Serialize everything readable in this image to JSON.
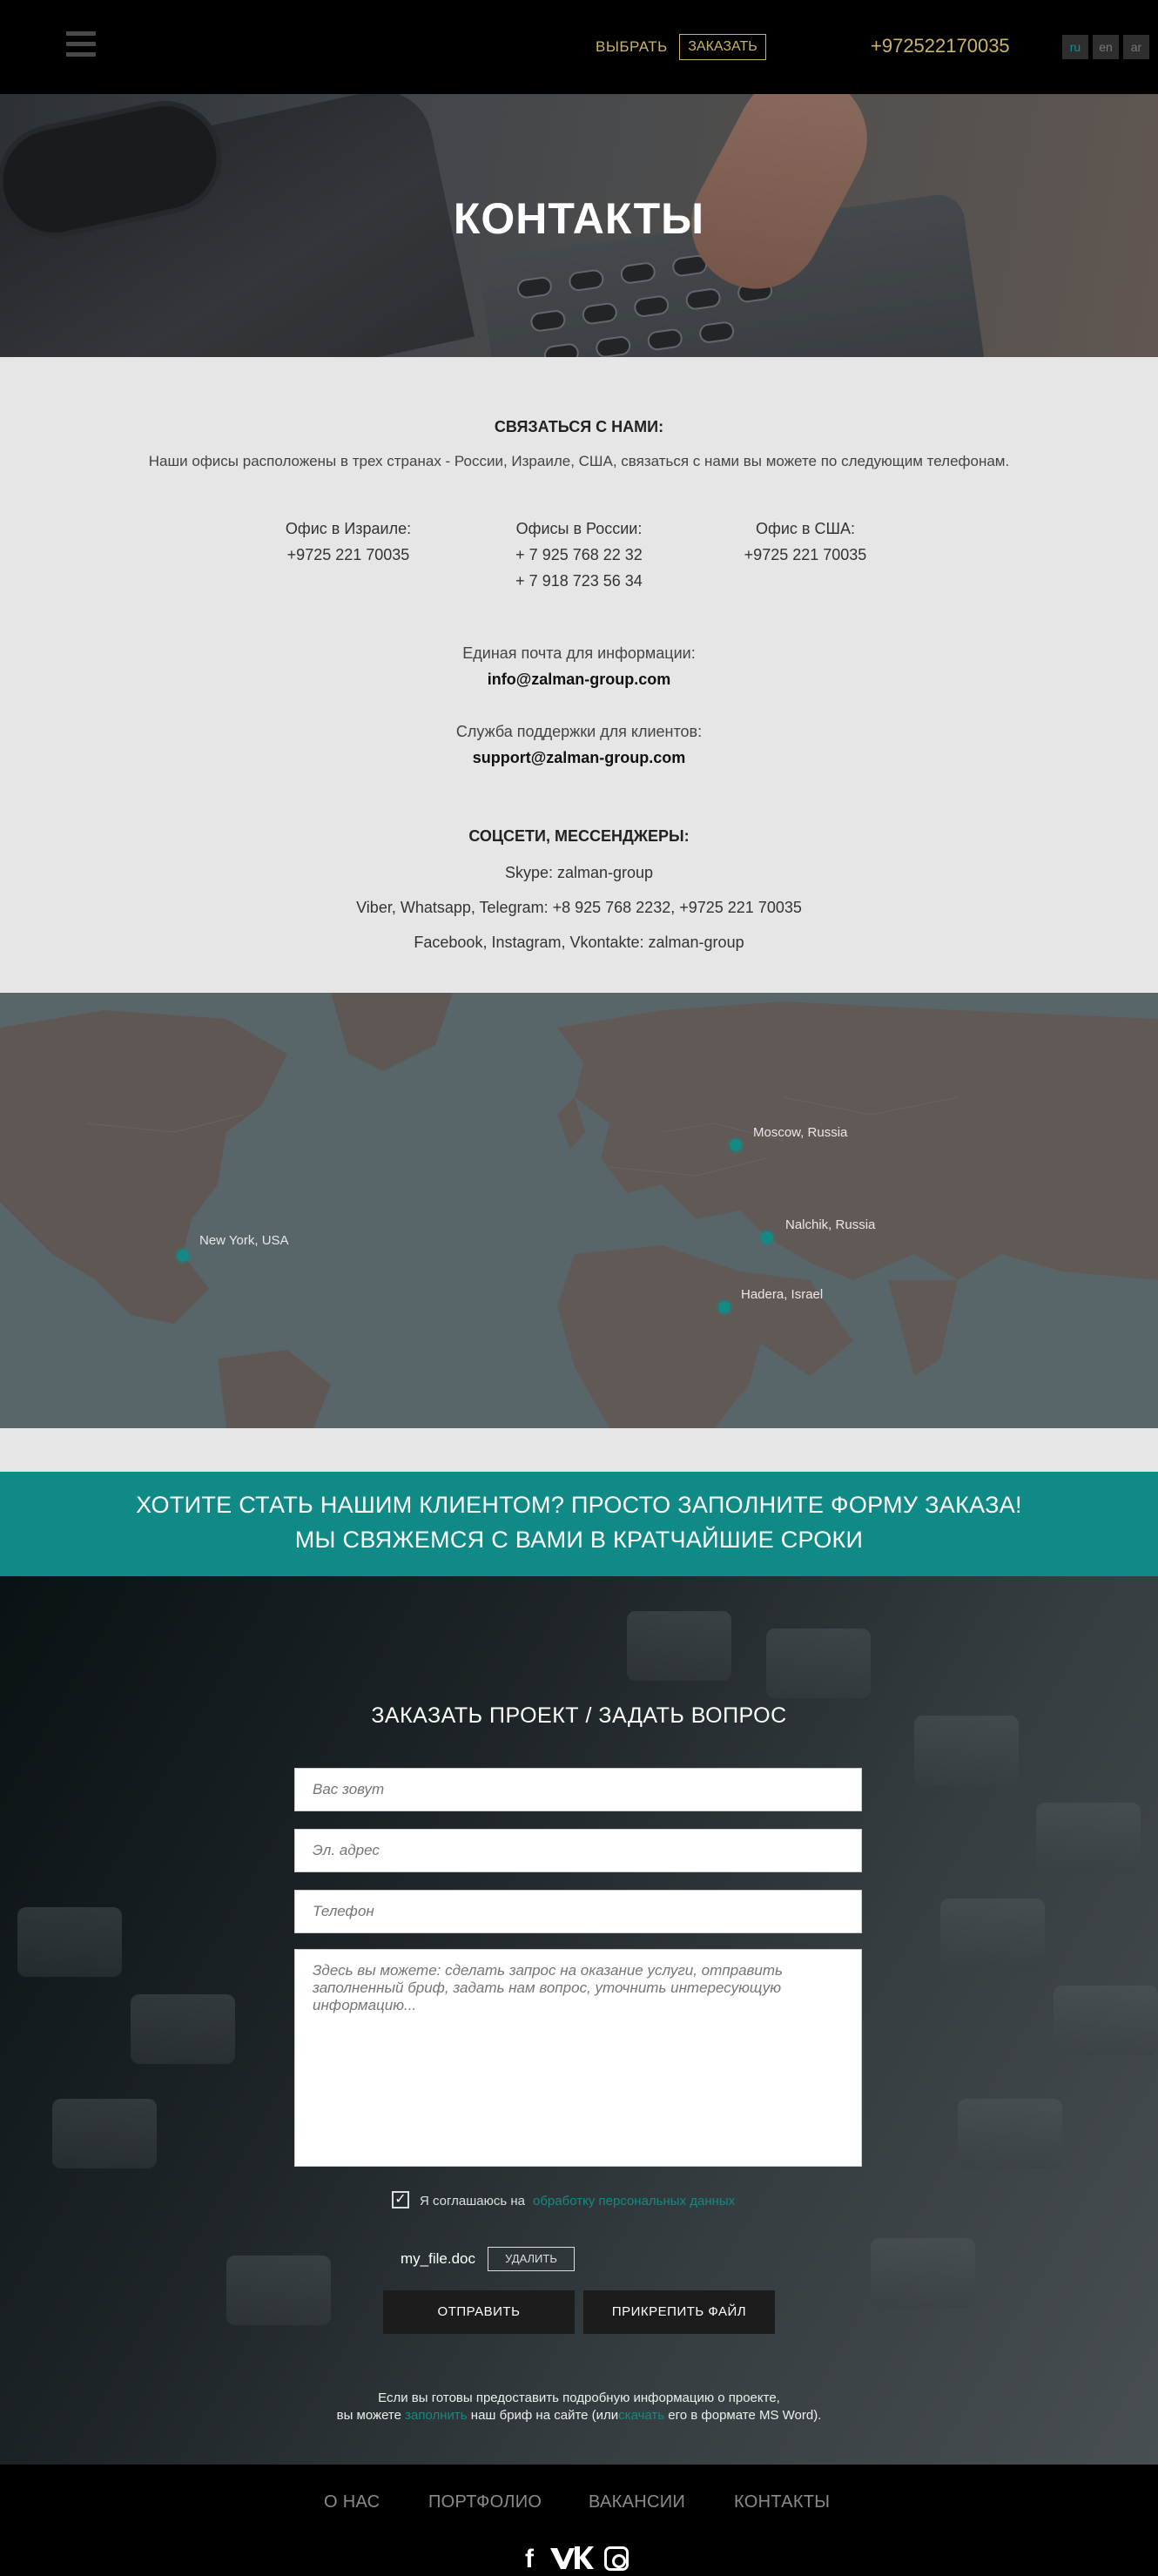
{
  "header": {
    "nav_choose": "ВЫБРАТЬ",
    "nav_order": "ЗАКАЗАТЬ",
    "phone": "+972522170035",
    "languages": [
      "ru",
      "en",
      "ar"
    ],
    "active_language": "ru",
    "accent_color": "#c9b46a"
  },
  "hero": {
    "title": "КОНТАКТЫ"
  },
  "contacts": {
    "title": "СВЯЗАТЬСЯ С НАМИ:",
    "intro": "Наши офисы расположены в трех странах - России, Израиле, США, связаться с нами вы можете по следующим телефонам.",
    "offices": [
      {
        "label": "Офис в Израиле:",
        "phones": [
          "+9725 221 70035"
        ]
      },
      {
        "label": "Офисы в России:",
        "phones": [
          "+ 7 925 768 22 32",
          "+ 7 918 723 56 34"
        ]
      },
      {
        "label": "Офис в США:",
        "phones": [
          "+9725 221 70035"
        ]
      }
    ],
    "email_label": "Единая почта для информации:",
    "email": "info@zalman-group.com",
    "support_label": "Служба поддержки для клиентов:",
    "support_email": "support@zalman-group.com",
    "social_title": "СОЦСЕТИ, МЕССЕНДЖЕРЫ:",
    "social_lines": [
      "Skype: zalman-group",
      "Viber, Whatsapp, Telegram: +8 925 768 2232, +9725 221 70035",
      "Facebook, Instagram, Vkontakte: zalman-group"
    ]
  },
  "map": {
    "markers": [
      "Moscow, Russia",
      "Nalchik, Russia",
      "Hadera, Israel",
      "New York, USA"
    ],
    "marker_color": "#138a86"
  },
  "cta": {
    "line1": "ХОТИТЕ СТАТЬ НАШИМ КЛИЕНТОМ?  ПРОСТО ЗАПОЛНИТЕ ФОРМУ ЗАКАЗА!",
    "line2": "МЫ СВЯЖЕМСЯ С ВАМИ В КРАТЧАЙШИЕ СРОКИ",
    "color": "#0f8a87"
  },
  "form": {
    "title": "ЗАКАЗАТЬ ПРОЕКТ / ЗАДАТЬ ВОПРОС",
    "name_placeholder": "Вас зовут",
    "email_placeholder": "Эл. адрес",
    "phone_placeholder": "Телефон",
    "message_placeholder": "Здесь вы можете: сделать запрос на оказание услуги, отправить заполненный бриф, задать нам вопрос, уточнить интересующую информацию...",
    "consent_checked": true,
    "consent_text": "Я соглашаюсь на",
    "consent_link": "обработку персональных данных",
    "file_name": "my_file.doc",
    "delete_label": "УДАЛИТЬ",
    "send_label": "ОТПРАВИТЬ",
    "attach_label": "ПРИКРЕПИТЬ ФАЙЛ",
    "note_line1": "Если вы готовы предоставить подробную информацию о проекте,",
    "note_line2_pre": "вы можете",
    "note_link1": "заполнить",
    "note_line2_mid": "наш бриф на сайте (или",
    "note_link2": "скачать",
    "note_line2_post": "его в формате MS Word)."
  },
  "footer": {
    "nav": [
      "О НАС",
      "ПОРТФОЛИО",
      "ВАКАНСИИ",
      "КОНТАКТЫ"
    ],
    "social_icons": [
      "facebook-icon",
      "vk-icon",
      "instagram-icon"
    ]
  }
}
